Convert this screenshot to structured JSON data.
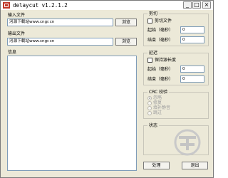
{
  "window": {
    "title": "delaycut v1.2.1.2",
    "minimize_label": "_",
    "maximize_label": "□",
    "close_label": "×"
  },
  "input": {
    "label": "输入文件",
    "value": "河源下载站www.cngr.cn",
    "browse_label": "浏览"
  },
  "output": {
    "label": "输出文件",
    "value": "河源下载站www.cngr.cn",
    "browse_label": "浏览"
  },
  "log": {
    "label": "信息"
  },
  "cut": {
    "title": "剪切",
    "checkbox_label": "剪切文件",
    "start_label": "起始（毫秒）",
    "start_value": "0",
    "end_label": "结束（毫秒）",
    "end_value": "0"
  },
  "delay": {
    "title": "延迟",
    "checkbox_label": "保持源长度",
    "start_label": "起始（毫秒）",
    "start_value": "0",
    "end_label": "结束（毫秒）",
    "end_value": "0"
  },
  "crc": {
    "title": "CRC 校验",
    "options": [
      "忽略",
      "修复",
      "填补静音",
      "跳过"
    ]
  },
  "status": {
    "title": "状态"
  },
  "actions": {
    "run_label": "处理",
    "exit_label": "退出"
  },
  "colors": {
    "window_bg": "#ece9d8",
    "field_border": "#7f9db9",
    "disabled_text": "#a0a0a0",
    "app_icon": "#c0392b"
  },
  "icons": {
    "app": "app-icon",
    "minimize": "minimize-icon",
    "maximize": "maximize-icon",
    "close": "close-icon",
    "watermark": "watermark-logo"
  }
}
